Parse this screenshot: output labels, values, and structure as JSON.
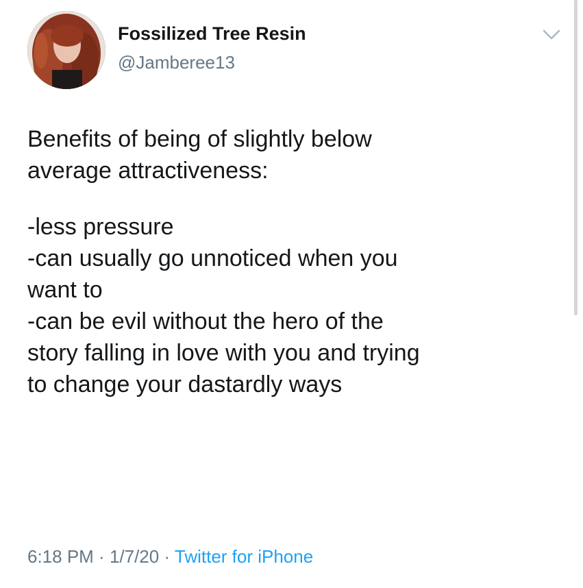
{
  "tweet": {
    "author": {
      "display_name": "Fossilized Tree Resin",
      "handle": "@Jamberee13"
    },
    "body": {
      "intro": [
        "Benefits of being of slightly below",
        "average attractiveness:"
      ],
      "list": [
        "-less pressure",
        "-can usually go unnoticed when you",
        "want to",
        "-can be evil without the hero of the",
        "story falling in love with you and trying",
        "to change your dastardly ways"
      ]
    },
    "meta": {
      "time": "6:18 PM",
      "sep1": " · ",
      "date": "1/7/20",
      "sep2": " · ",
      "source": "Twitter for iPhone"
    }
  },
  "colors": {
    "text": "#14171a",
    "secondary": "#657786",
    "link": "#1da1f2",
    "caret": "#aab8c2"
  },
  "icons": {
    "menu_caret": "chevron-down-icon"
  }
}
